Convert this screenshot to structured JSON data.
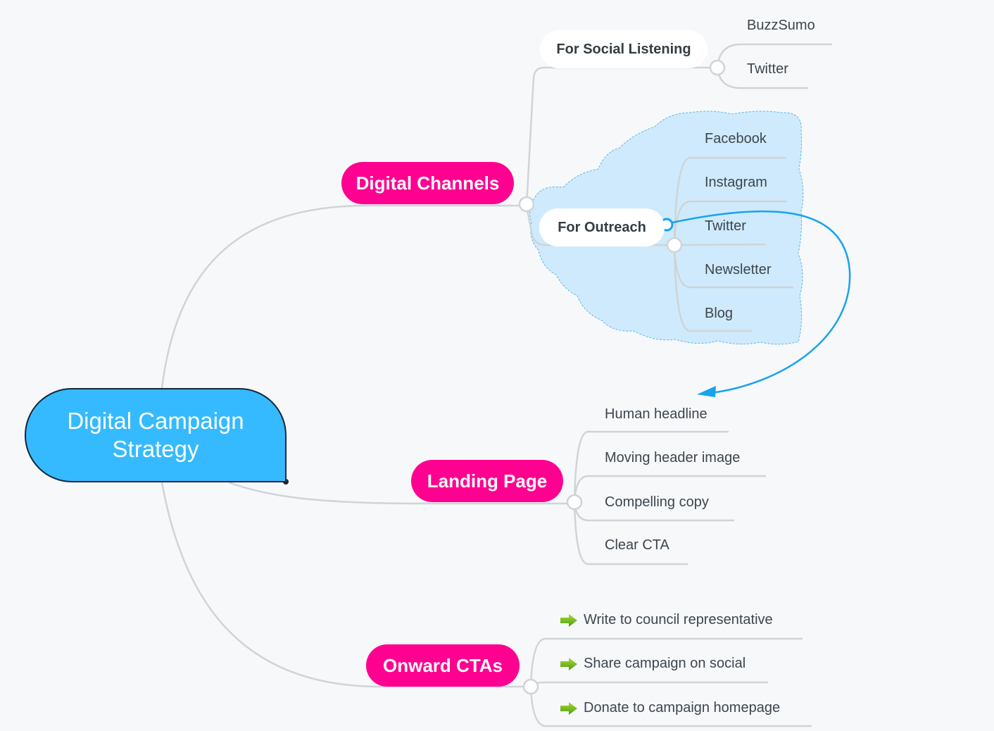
{
  "central": {
    "label": "Digital Campaign Strategy"
  },
  "colors": {
    "central_fill": "#35baff",
    "main_topic_fill": "#ff0090",
    "boundary_fill": "#cfeafc",
    "relationship_line": "#16a3f0",
    "branch_line": "#cfd4d8"
  },
  "topics": [
    {
      "label": "Digital Channels",
      "subtopics": [
        {
          "label": "For Social Listening",
          "children": [
            "BuzzSumo",
            "Twitter"
          ]
        },
        {
          "label": "For Outreach",
          "children": [
            "Facebook",
            "Instagram",
            "Twitter",
            "Newsletter",
            "Blog"
          ],
          "boundary": true
        }
      ]
    },
    {
      "label": "Landing Page",
      "children": [
        "Human headline",
        "Moving header image",
        "Compelling copy",
        "Clear CTA"
      ]
    },
    {
      "label": "Onward CTAs",
      "children": [
        {
          "label": "Write to council representative",
          "icon": "green-arrow-right-icon"
        },
        {
          "label": "Share campaign on social",
          "icon": "green-arrow-right-icon"
        },
        {
          "label": "Donate to campaign homepage",
          "icon": "green-arrow-right-icon"
        }
      ]
    }
  ],
  "relationship": {
    "from": "For Outreach",
    "to": "Landing Page children"
  }
}
